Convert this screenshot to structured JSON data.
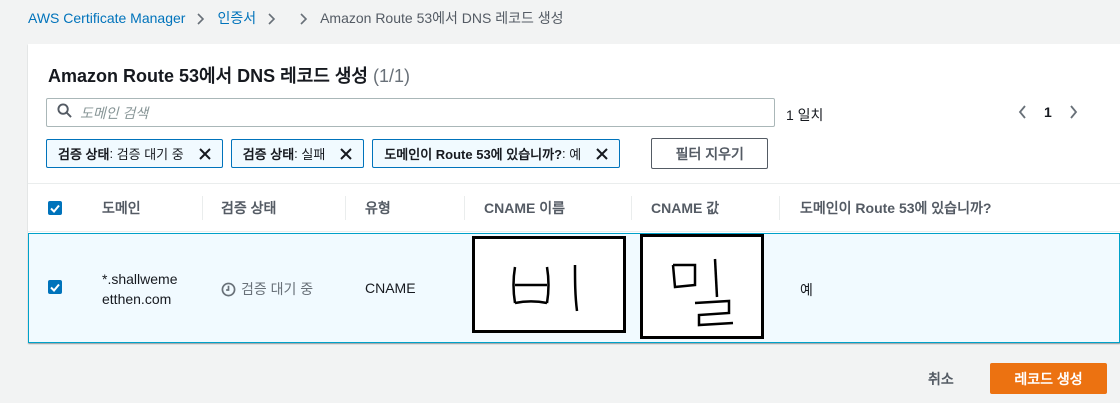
{
  "breadcrumb": {
    "items": [
      "AWS Certificate Manager",
      "인증서"
    ],
    "current": "Amazon Route 53에서 DNS 레코드 생성"
  },
  "panel": {
    "title": "Amazon Route 53에서 DNS 레코드 생성",
    "count": "(1/1)"
  },
  "search": {
    "placeholder": "도메인 검색",
    "value": ""
  },
  "match_count": "1 일치",
  "pagination": {
    "current_page": "1"
  },
  "filters": [
    {
      "key": "검증 상태",
      "value": "검증 대기 중"
    },
    {
      "key": "검증 상태",
      "value": "실패"
    },
    {
      "key": "도메인이 Route 53에 있습니까?",
      "value": "예"
    }
  ],
  "clear_filters_label": "필터 지우기",
  "table": {
    "columns": [
      "도메인",
      "검증 상태",
      "유형",
      "CNAME 이름",
      "CNAME 값",
      "도메인이 Route 53에 있습니까?"
    ],
    "rows": [
      {
        "selected": true,
        "domain_line1": "*.shallweme",
        "domain_line2": "etthen.com",
        "status": "검증 대기 중",
        "type": "CNAME",
        "cname_name": "비",
        "cname_value": "밀",
        "in_route53": "예"
      }
    ]
  },
  "footer": {
    "cancel_label": "취소",
    "submit_label": "레코드 생성"
  },
  "colors": {
    "link": "#0073bb",
    "primary": "#ec7211",
    "selected_row_bg": "#f1faff",
    "selected_row_border": "#00a1c9"
  }
}
